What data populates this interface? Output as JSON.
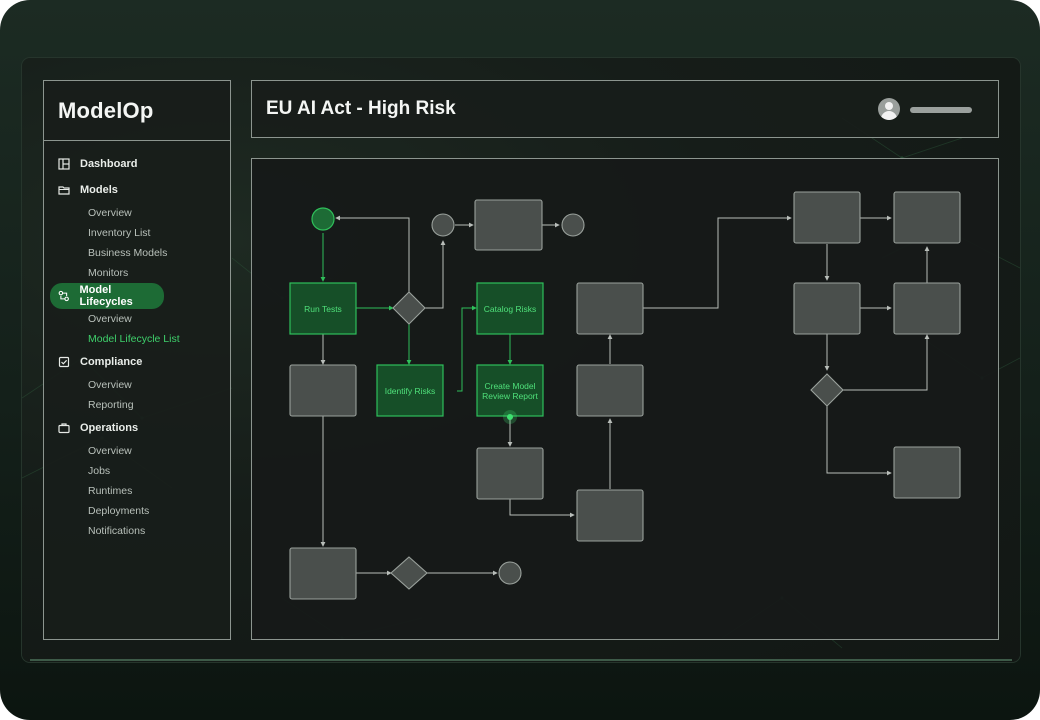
{
  "app": {
    "logo": "ModelOp"
  },
  "header": {
    "title": "EU AI Act - High Risk"
  },
  "sidebar": {
    "sections": [
      {
        "label": "Dashboard",
        "icon": "dashboard-icon",
        "items": []
      },
      {
        "label": "Models",
        "icon": "folder-icon",
        "items": [
          "Overview",
          "Inventory List",
          "Business Models",
          "Monitors"
        ]
      },
      {
        "label": "Model Lifecycles",
        "icon": "lifecycle-icon",
        "active": true,
        "items": [
          "Overview",
          "Model Lifecycle List"
        ],
        "current_item": "Model Lifecycle List"
      },
      {
        "label": "Compliance",
        "icon": "checklist-icon",
        "items": [
          "Overview",
          "Reporting"
        ]
      },
      {
        "label": "Operations",
        "icon": "briefcase-icon",
        "items": [
          "Overview",
          "Jobs",
          "Runtimes",
          "Deployments",
          "Notifications"
        ]
      }
    ]
  },
  "flow": {
    "labels": {
      "run_tests": "Run Tests",
      "identify_risks": "Identify Risks",
      "catalog_risks": "Catalog Risks",
      "create_report": "Create Model Review Report"
    }
  },
  "colors": {
    "accent_green": "#1d6b35",
    "active_text_green": "#3ed06b",
    "node_fill": "#4a4f4c",
    "node_border": "#9aa19c",
    "panel_border": "#8c958f"
  }
}
